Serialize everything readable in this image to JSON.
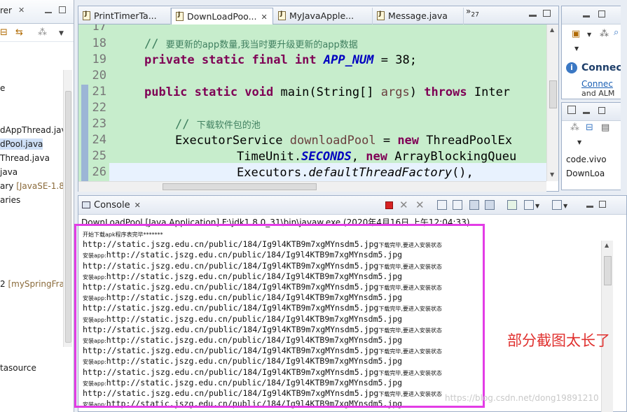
{
  "explorer": {
    "tab_label": "rer",
    "items": [
      {
        "text": "e",
        "selected": false
      },
      {
        "text": "dAppThread.java",
        "selected": false
      },
      {
        "text": "dPool.java",
        "selected": true
      },
      {
        "text": "Thread.java",
        "selected": false
      },
      {
        "text": "java",
        "selected": false
      },
      {
        "text": "ary",
        "decor": " [JavaSE-1.8]",
        "selected": false
      },
      {
        "text": "aries",
        "selected": false
      },
      {
        "text": "2",
        "decor": "  [mySpringFra",
        "selected": false
      },
      {
        "text": "tasource",
        "selected": false
      }
    ]
  },
  "editor": {
    "tabs": [
      {
        "label": "PrintTimerTa...",
        "active": false
      },
      {
        "label": "DownLoadPoo...",
        "active": true
      },
      {
        "label": "MyJavaApple...",
        "active": false
      },
      {
        "label": "Message.java",
        "active": false
      }
    ],
    "overflow_label": "»",
    "overflow_count": "27",
    "line_numbers": [
      "17",
      "18",
      "19",
      "20",
      "21",
      "22",
      "23",
      "24",
      "25",
      "26"
    ],
    "comment_18_prefix": "// ",
    "comment_18_text": "要更新的app数量,我当时要升级更新的app数据",
    "line19": {
      "kw": "private static final int ",
      "field": "APP_NUM",
      "rest": " = 38;"
    },
    "line21": {
      "kw1": "public static void ",
      "name": "main(String[] ",
      "param": "args",
      "sp": ") ",
      "kw2": "throws",
      "rest": " Inter"
    },
    "comment_23_prefix": "// ",
    "comment_23_text": "下载软件包的池",
    "line24": {
      "type": "ExecutorService ",
      "var": "downloadPool",
      "mid": " = ",
      "kw": "new",
      "rest": " ThreadPoolEx"
    },
    "line25": {
      "pre": "TimeUnit.",
      "const": "SECONDS",
      "mid": ", ",
      "kw": "new",
      "rest": " ArrayBlockingQueu"
    },
    "line26": {
      "pre": "Executors.",
      "method": "defaultThreadFactory",
      "rest": "(),"
    }
  },
  "right_top": {
    "title": "Connec",
    "link": "Connec",
    "tail": "and ALM"
  },
  "right_mid": {
    "items": [
      "code.vivo",
      "DownLoa"
    ]
  },
  "console": {
    "tab_label": "Console",
    "header": "DownLoadPool [Java Application] F:\\jdk1.8.0_31\\bin\\javaw.exe (2020年4月16日 上午12:04:33)",
    "first_line": "开始下载apk程序表完毕*******",
    "url": "http://static.jszg.edu.cn/public/184/Ig9l4KTB9m7xgMYnsdm5.jpg",
    "download_suffix": "下载完毕,要进入安装状态",
    "install_prefix": "安装app:",
    "pair_count": 8
  },
  "annotation": "部分截图太长了",
  "watermark": "https://blog.csdn.net/dong19891210",
  "colors": {
    "editor_bg": "#c7edcc",
    "keyword": "#7f0055",
    "comment": "#3f7f5f",
    "field": "#0000c0",
    "highlight_box": "#e33ce6",
    "annotation": "#e0312f"
  }
}
